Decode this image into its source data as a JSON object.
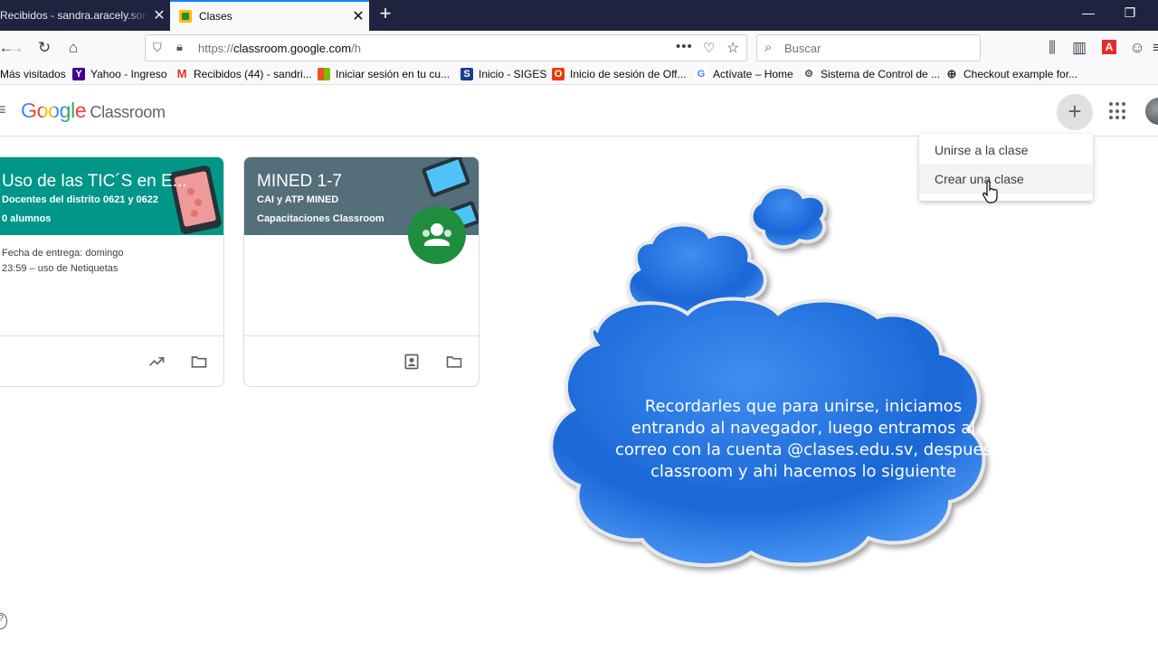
{
  "browser": {
    "tabs": [
      {
        "title": "Recibidos - sandra.aracely.sorto",
        "active": false
      },
      {
        "title": "Clases",
        "active": true
      }
    ],
    "url": {
      "prefix": "https://",
      "domain": "classroom.google.com",
      "path": "/h"
    },
    "search_placeholder": "Buscar",
    "bookmarks": [
      {
        "label": "Más visitados",
        "icon": "star-folder-icon"
      },
      {
        "label": "Yahoo - Ingreso",
        "icon": "yahoo-icon"
      },
      {
        "label": "Recibidos (44) - sandri...",
        "icon": "gmail-icon"
      },
      {
        "label": "Iniciar sesión en tu cu...",
        "icon": "microsoft-icon"
      },
      {
        "label": "Inicio - SIGES",
        "icon": "siges-icon"
      },
      {
        "label": "Inicio de sesión de Off...",
        "icon": "office-icon"
      },
      {
        "label": "Actívate – Home",
        "icon": "google-icon"
      },
      {
        "label": "Sistema de Control de ...",
        "icon": "control-icon"
      },
      {
        "label": "Checkout example for...",
        "icon": "globe-icon"
      }
    ]
  },
  "app": {
    "logo_google": "Google",
    "logo_product": "Classroom",
    "menu": {
      "items": [
        "Unirse a la clase",
        "Crear una clase"
      ],
      "hovered_index": 1
    }
  },
  "cards": [
    {
      "title": "Uso de las TIC´S en E...",
      "subtitle": "Docentes del distrito 0621 y 0622",
      "meta": "0 alumnos",
      "due_line1": "Fecha de entrega: domingo",
      "due_line2": "23:59 – uso de Netiquetas",
      "banner_color": "#009688"
    },
    {
      "title": "MINED 1-7",
      "subtitle": "CAI y ATP MINED",
      "meta": "Capacitaciones Classroom",
      "banner_color": "#546e7a"
    }
  ],
  "annotation": {
    "text": "Recordarles que para unirse, iniciamos entrando al navegador, luego entramos al correo con la cuenta @clases.edu.sv, despues classroom y ahi hacemos lo siguiente"
  },
  "colors": {
    "tab_strip": "#202340",
    "cloud_fill": "#1a66d6",
    "accent_blue": "#0a84ff"
  }
}
